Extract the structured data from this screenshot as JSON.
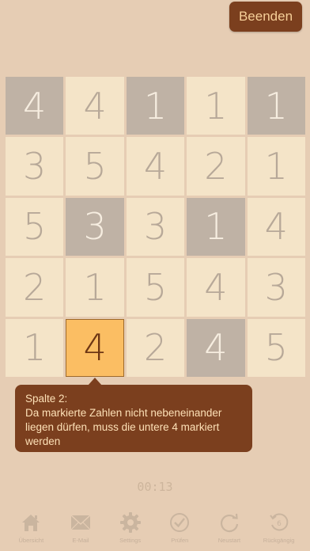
{
  "header": {
    "end_button": "Beenden"
  },
  "board": {
    "rows": [
      [
        {
          "v": "4",
          "m": true
        },
        {
          "v": "4",
          "m": false
        },
        {
          "v": "1",
          "m": true
        },
        {
          "v": "1",
          "m": false
        },
        {
          "v": "1",
          "m": true
        }
      ],
      [
        {
          "v": "3",
          "m": false
        },
        {
          "v": "5",
          "m": false
        },
        {
          "v": "4",
          "m": false
        },
        {
          "v": "2",
          "m": false
        },
        {
          "v": "1",
          "m": false
        }
      ],
      [
        {
          "v": "5",
          "m": false
        },
        {
          "v": "3",
          "m": true
        },
        {
          "v": "3",
          "m": false
        },
        {
          "v": "1",
          "m": true
        },
        {
          "v": "4",
          "m": false
        }
      ],
      [
        {
          "v": "2",
          "m": false
        },
        {
          "v": "1",
          "m": false
        },
        {
          "v": "5",
          "m": false
        },
        {
          "v": "4",
          "m": false
        },
        {
          "v": "3",
          "m": false
        }
      ],
      [
        {
          "v": "1",
          "m": false
        },
        {
          "v": "4",
          "m": false,
          "sel": true
        },
        {
          "v": "2",
          "m": false
        },
        {
          "v": "4",
          "m": true
        },
        {
          "v": "5",
          "m": false
        }
      ]
    ],
    "colors": {
      "cell": "#f4e4c8",
      "marked": "#bfb2a5",
      "selected": "#fbbe63"
    }
  },
  "hint": {
    "title": "Spalte 2:",
    "text": "Da markierte Zahlen nicht nebeneinander liegen dürfen, muss die untere 4 markiert werden"
  },
  "timer": "00:13",
  "toolbar": [
    {
      "label": "Übersicht",
      "icon": "home-icon"
    },
    {
      "label": "E-Mail",
      "icon": "mail-icon"
    },
    {
      "label": "Settings",
      "icon": "gear-icon"
    },
    {
      "label": "Prüfen",
      "icon": "check-circle-icon"
    },
    {
      "label": "Neustart",
      "icon": "restart-icon"
    },
    {
      "label": "Rückgängig",
      "icon": "undo-icon"
    }
  ],
  "undo_count": "6"
}
